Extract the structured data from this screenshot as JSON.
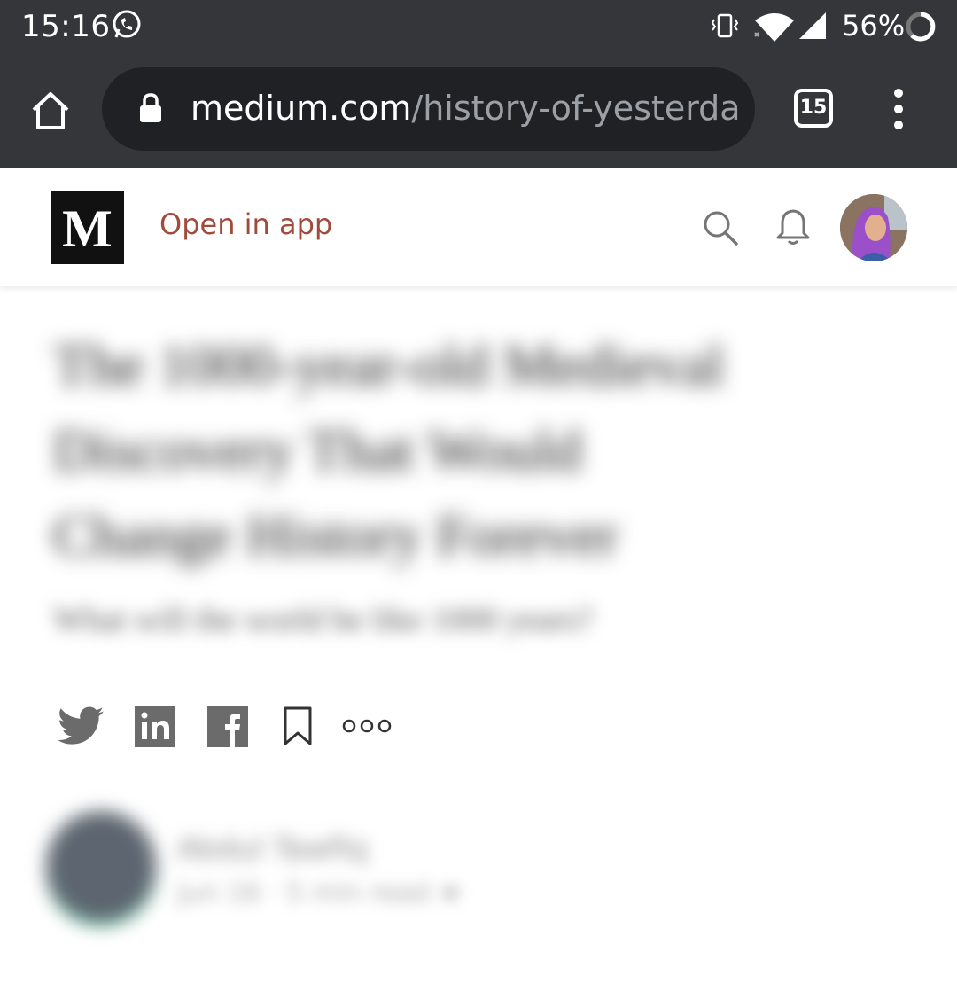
{
  "status_bar": {
    "time": "15:16",
    "battery_percent": "56%",
    "icons": [
      "whatsapp-icon",
      "vibrate-icon",
      "wifi-icon",
      "cell-signal-icon",
      "battery-ring-icon"
    ]
  },
  "browser": {
    "url_domain": "medium.com",
    "url_path": "/history-of-yesterday/hc",
    "tab_count": "15",
    "colors": {
      "toolbar": "#35363a",
      "omnibox": "#202124",
      "url_path": "#9aa0a6"
    }
  },
  "medium_header": {
    "logo_text": "M",
    "open_in_app_label": "Open in app",
    "accent_color": "#a04b3c"
  },
  "article": {
    "title_lines": [
      "The 1000-year-old Medieval",
      "Discovery That Would",
      "Change History Forever"
    ],
    "subtitle": "What will the world be like 1000 years?",
    "share_icons": [
      "twitter-icon",
      "linkedin-icon",
      "facebook-icon",
      "bookmark-icon",
      "more-icon"
    ],
    "author_name": "Abdul Tawfiq",
    "author_meta": "Jun 16 · 5 min read ★"
  }
}
